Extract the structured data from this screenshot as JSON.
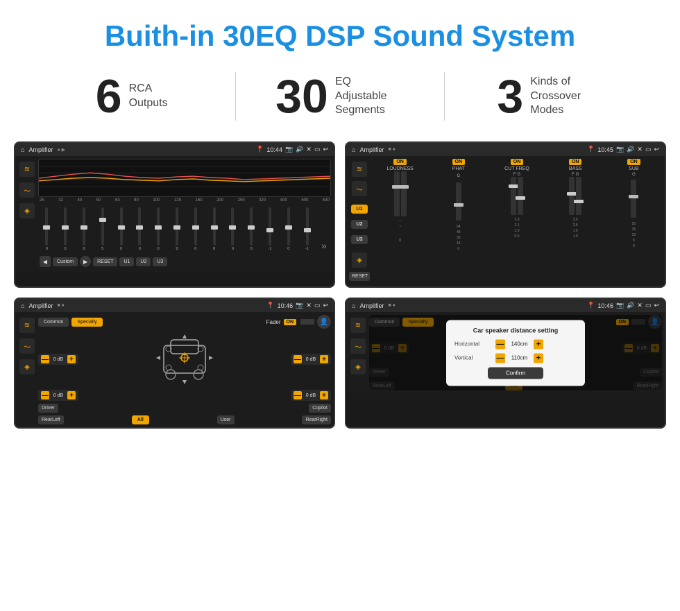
{
  "page": {
    "title": "Buith-in 30EQ DSP Sound System",
    "title_color": "#1a8fe3"
  },
  "stats": [
    {
      "number": "6",
      "label_line1": "RCA",
      "label_line2": "Outputs"
    },
    {
      "number": "30",
      "label_line1": "EQ Adjustable",
      "label_line2": "Segments"
    },
    {
      "number": "3",
      "label_line1": "Kinds of",
      "label_line2": "Crossover Modes"
    }
  ],
  "screens": {
    "eq": {
      "topbar": {
        "app": "Amplifier",
        "time": "10:44"
      },
      "freq_labels": [
        "25",
        "32",
        "40",
        "50",
        "63",
        "80",
        "100",
        "125",
        "160",
        "200",
        "250",
        "320",
        "400",
        "500",
        "630"
      ],
      "slider_values": [
        "0",
        "0",
        "0",
        "5",
        "0",
        "0",
        "0",
        "0",
        "0",
        "0",
        "0",
        "0",
        "-1",
        "0",
        "-1"
      ],
      "bottom_buttons": [
        "Custom",
        "RESET",
        "U1",
        "U2",
        "U3"
      ]
    },
    "crossover": {
      "topbar": {
        "app": "Amplifier",
        "time": "10:45"
      },
      "u_buttons": [
        "U1",
        "U2",
        "U3"
      ],
      "channels": [
        {
          "label": "LOUDNESS",
          "on": true
        },
        {
          "label": "PHAT",
          "on": true
        },
        {
          "label": "CUT FREQ",
          "on": true
        },
        {
          "label": "BASS",
          "on": true
        },
        {
          "label": "SUB",
          "on": true
        }
      ],
      "reset_btn": "RESET"
    },
    "fader": {
      "topbar": {
        "app": "Amplifier",
        "time": "10:46"
      },
      "tabs": [
        "Common",
        "Specialty"
      ],
      "active_tab": "Specialty",
      "fader_label": "Fader",
      "on_label": "ON",
      "db_values": [
        "0 dB",
        "0 dB",
        "0 dB",
        "0 dB"
      ],
      "bottom_buttons": [
        "Driver",
        "All",
        "RearLeft",
        "User",
        "RearRight",
        "Copilot"
      ]
    },
    "distance": {
      "topbar": {
        "app": "Amplifier",
        "time": "10:46"
      },
      "dialog": {
        "title": "Car speaker distance setting",
        "horizontal_label": "Horizontal",
        "horizontal_value": "140cm",
        "vertical_label": "Vertical",
        "vertical_value": "110cm",
        "confirm_btn": "Confirm"
      }
    }
  },
  "icons": {
    "home": "⌂",
    "settings": "≡",
    "back": "↩",
    "arrow_left": "◀",
    "arrow_right": "▶",
    "arrow_double": "»",
    "eq_icon": "≋",
    "wave_icon": "〜",
    "speaker_icon": "◈",
    "pin_icon": "📍",
    "camera": "📷",
    "volume": "🔊",
    "phone": "📱",
    "minus": "—",
    "plus": "+"
  }
}
